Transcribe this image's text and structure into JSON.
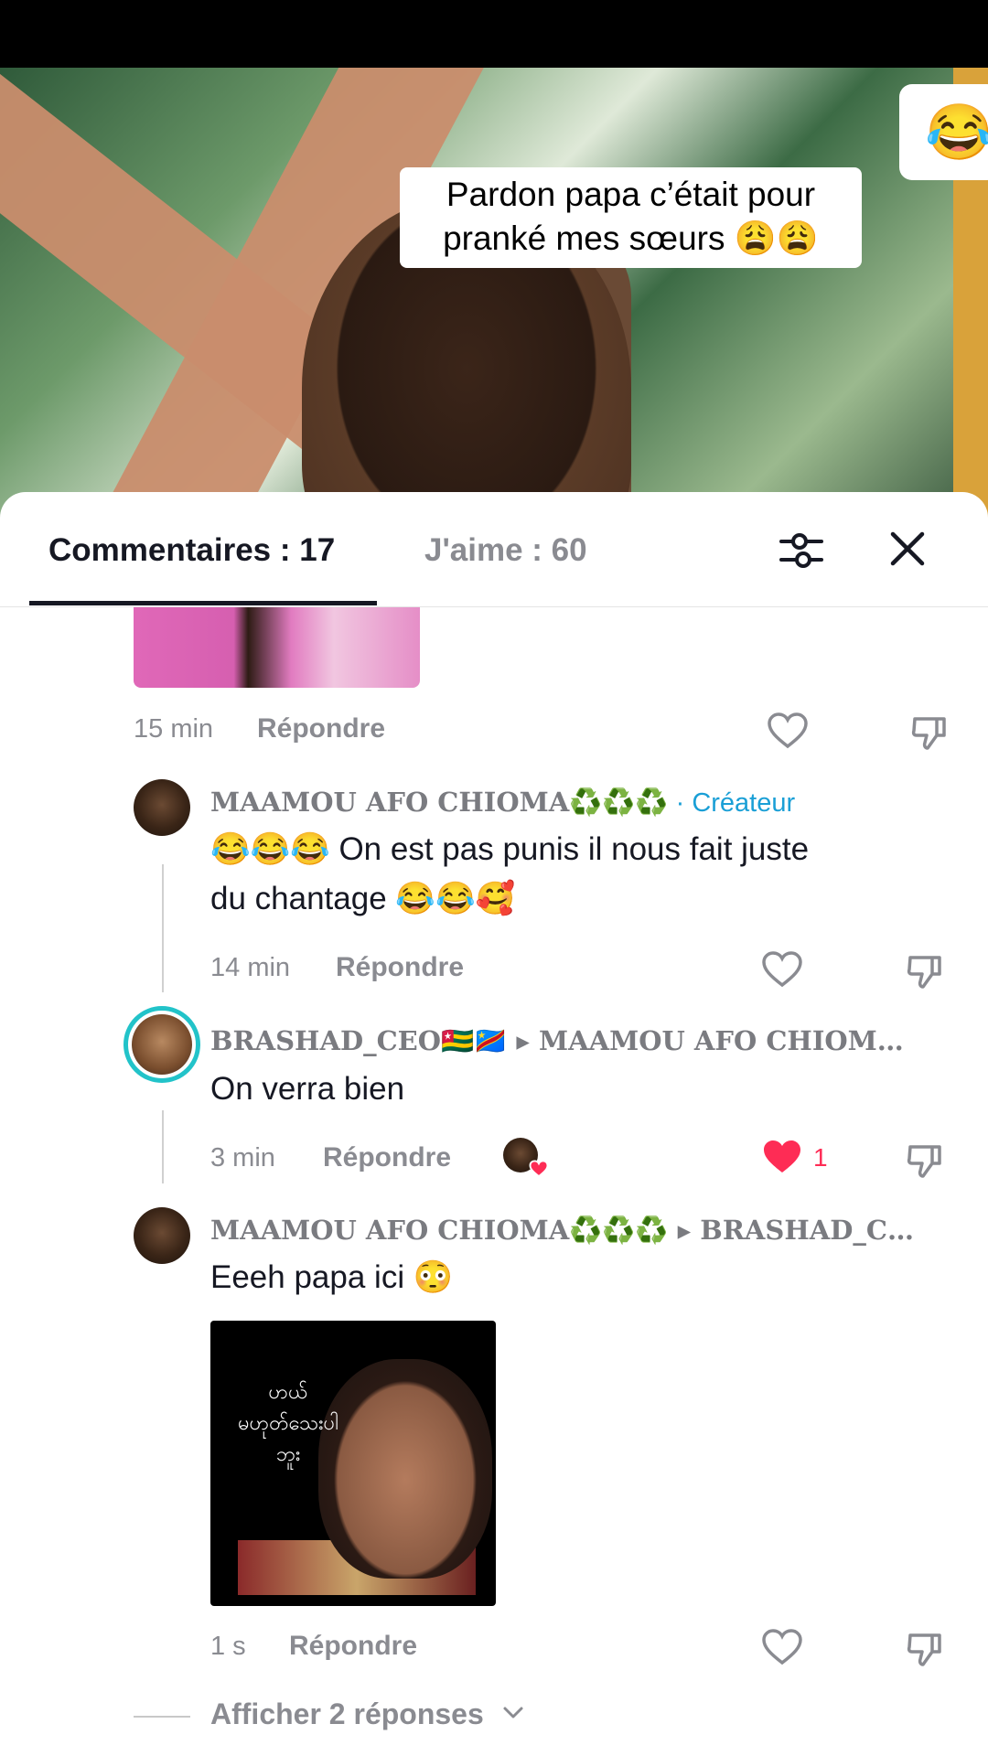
{
  "video": {
    "caption_line1": "Pardon papa c’était pour",
    "caption_line2": "pranké mes sœurs 😩😩",
    "side_emoji": "😂"
  },
  "tabs": {
    "comments_label": "Commentaires : 17",
    "likes_label": "J'aime : 60"
  },
  "comments": [
    {
      "time": "15 min",
      "reply_label": "Répondre",
      "image": "gif-thumbnail-pink"
    },
    {
      "username": "MAAMOU AFO CHIOMA♻️♻️♻️",
      "badge": " · Créateur",
      "text_line1": "😂😂😂 On est pas punis il nous fait juste",
      "text_line2": "du chantage 😂😂🥰",
      "time": "14 min",
      "reply_label": "Répondre"
    },
    {
      "username": "BRASHAD_CEO🇹🇬🇨🇩",
      "reply_to": "▸ MAAMOU AFO CHIOM…",
      "text": "On verra bien",
      "time": "3 min",
      "reply_label": "Répondre",
      "likes": "1",
      "liked": true
    },
    {
      "username": "MAAMOU AFO CHIOMA♻️♻️♻️",
      "reply_to": "▸ BRASHAD_C…",
      "text": "Eeeh papa ici 😳",
      "gif_text": "ဟယ်\nမဟုတ်သေးပါ\nဘူး",
      "time": "1 s",
      "reply_label": "Répondre"
    }
  ],
  "more_replies": "Afficher 2 réponses",
  "colors": {
    "accent_red": "#fe2c55",
    "creator_blue": "#1a9fd6",
    "ring_teal": "#22c3c9"
  }
}
